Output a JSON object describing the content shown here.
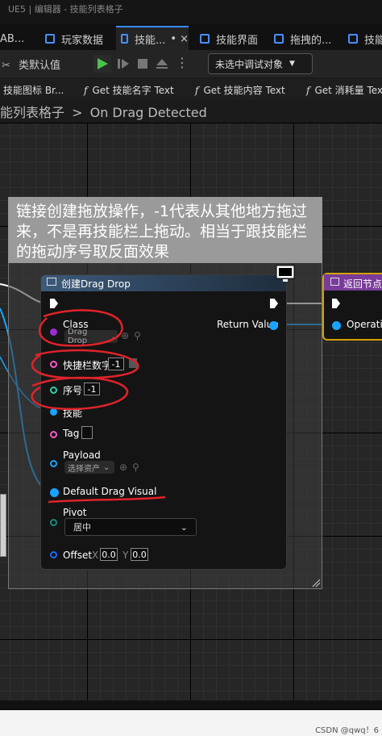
{
  "window": {
    "title": "UE5 | 编辑器 - 技能列表格子"
  },
  "tabs": [
    {
      "label": "AB..."
    },
    {
      "label": "玩家数据"
    },
    {
      "label": "技能..."
    },
    {
      "label": "技能界面"
    },
    {
      "label": "拖拽的..."
    },
    {
      "label": "技能栏"
    }
  ],
  "active_tab_close": "×",
  "active_tab_dot": "•",
  "toolbar": {
    "class_defaults_label": "类默认值",
    "debug_filter": "未选中调试对象",
    "more": "⋮"
  },
  "function_tabs": [
    {
      "label": "技能图标 Br..."
    },
    {
      "label": "Get 技能名字 Text"
    },
    {
      "label": "Get 技能内容 Text"
    },
    {
      "label": "Get 消耗量 Text"
    }
  ],
  "breadcrumb": {
    "parent": "能列表格子",
    "separator": ">",
    "current": "On Drag Detected"
  },
  "comment": {
    "text": "链接创建拖放操作，-1代表从其他地方拖过来，不是再技能栏上拖动。相当于跟技能栏的拖动序号取反面效果"
  },
  "node": {
    "title": "创建Drag Drop",
    "class_label": "Class",
    "class_value": "Drag Drop",
    "quickbar_label": "快捷栏数字",
    "quickbar_value": "-1",
    "index_label": "序号",
    "index_value": "-1",
    "skill_label": "技能",
    "tag_label": "Tag",
    "payload_label": "Payload",
    "payload_value": "选择资产",
    "default_visual_label": "Default Drag Visual",
    "pivot_label": "Pivot",
    "pivot_value": "居中",
    "offset_label": "Offset",
    "offset_x_label": "X",
    "offset_x": "0.0",
    "offset_y_label": "Y",
    "offset_y": "0.0",
    "return_label": "Return Value"
  },
  "return_node": {
    "title": "返回节点",
    "operation_label": "Operation"
  },
  "watermark": "CSDN @qwq！6",
  "colors": {
    "accent": "#3a8bff",
    "object_pin": "#1aa3ff",
    "class_pin": "#9a2fd0",
    "int_pin": "#2fd1a8",
    "struct_pin": "#ff58c8",
    "highlight": "#e0232a"
  }
}
